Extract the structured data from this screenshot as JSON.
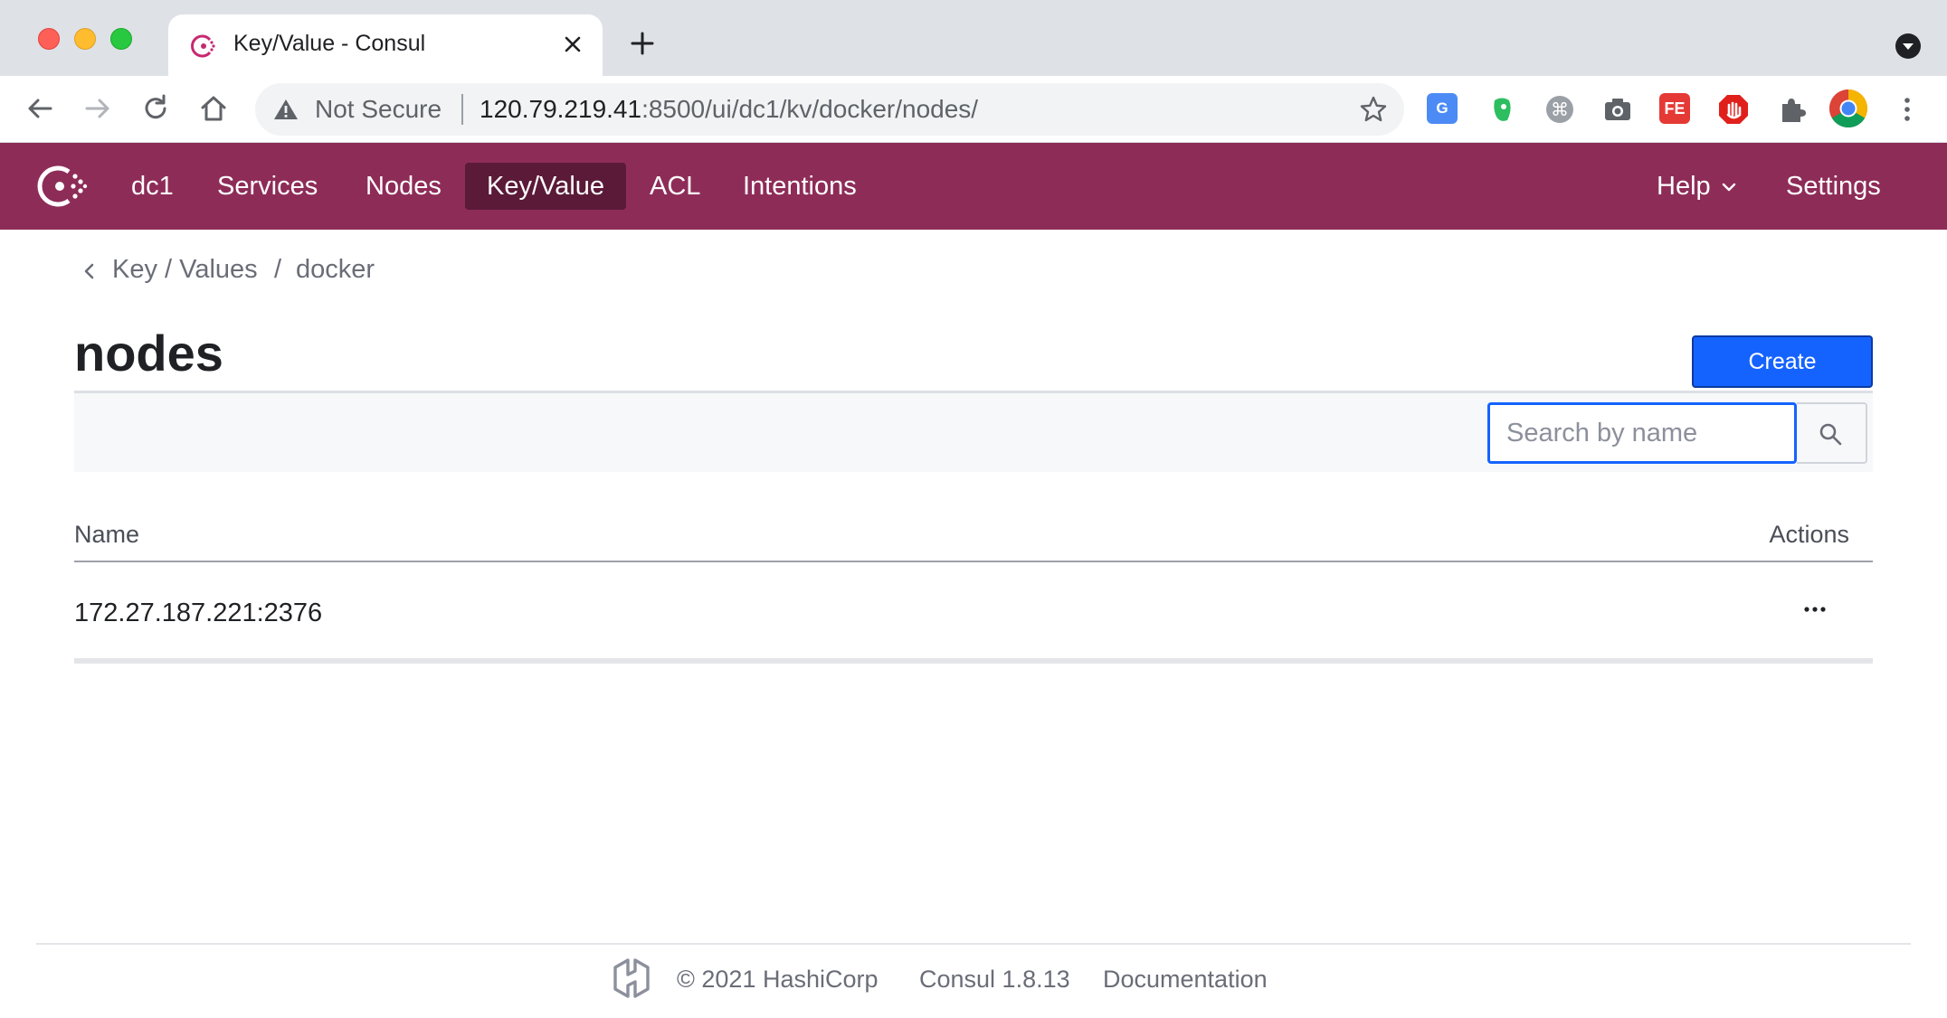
{
  "browser": {
    "tab_title": "Key/Value - Consul",
    "not_secure_label": "Not Secure",
    "url_host": "120.79.219.41",
    "url_path": ":8500/ui/dc1/kv/docker/nodes/"
  },
  "nav": {
    "datacenter": "dc1",
    "items": [
      {
        "label": "Services"
      },
      {
        "label": "Nodes"
      },
      {
        "label": "Key/Value"
      },
      {
        "label": "ACL"
      },
      {
        "label": "Intentions"
      }
    ],
    "help_label": "Help",
    "settings_label": "Settings",
    "active_color": "#5a1a38",
    "brand_color": "#8e2c58"
  },
  "breadcrumb": {
    "items": [
      "Key / Values",
      "docker"
    ],
    "separator": "/"
  },
  "page": {
    "title": "nodes",
    "create_label": "Create"
  },
  "search": {
    "placeholder": "Search by name",
    "value": ""
  },
  "table": {
    "columns": [
      "Name",
      "Actions"
    ],
    "rows": [
      {
        "name": "172.27.187.221:2376",
        "actions_icon": "more-horizontal-icon"
      }
    ]
  },
  "footer": {
    "copyright": "© 2021 HashiCorp",
    "version": "Consul 1.8.13",
    "docs_label": "Documentation"
  },
  "icons": {
    "accent": "#1563ff"
  }
}
